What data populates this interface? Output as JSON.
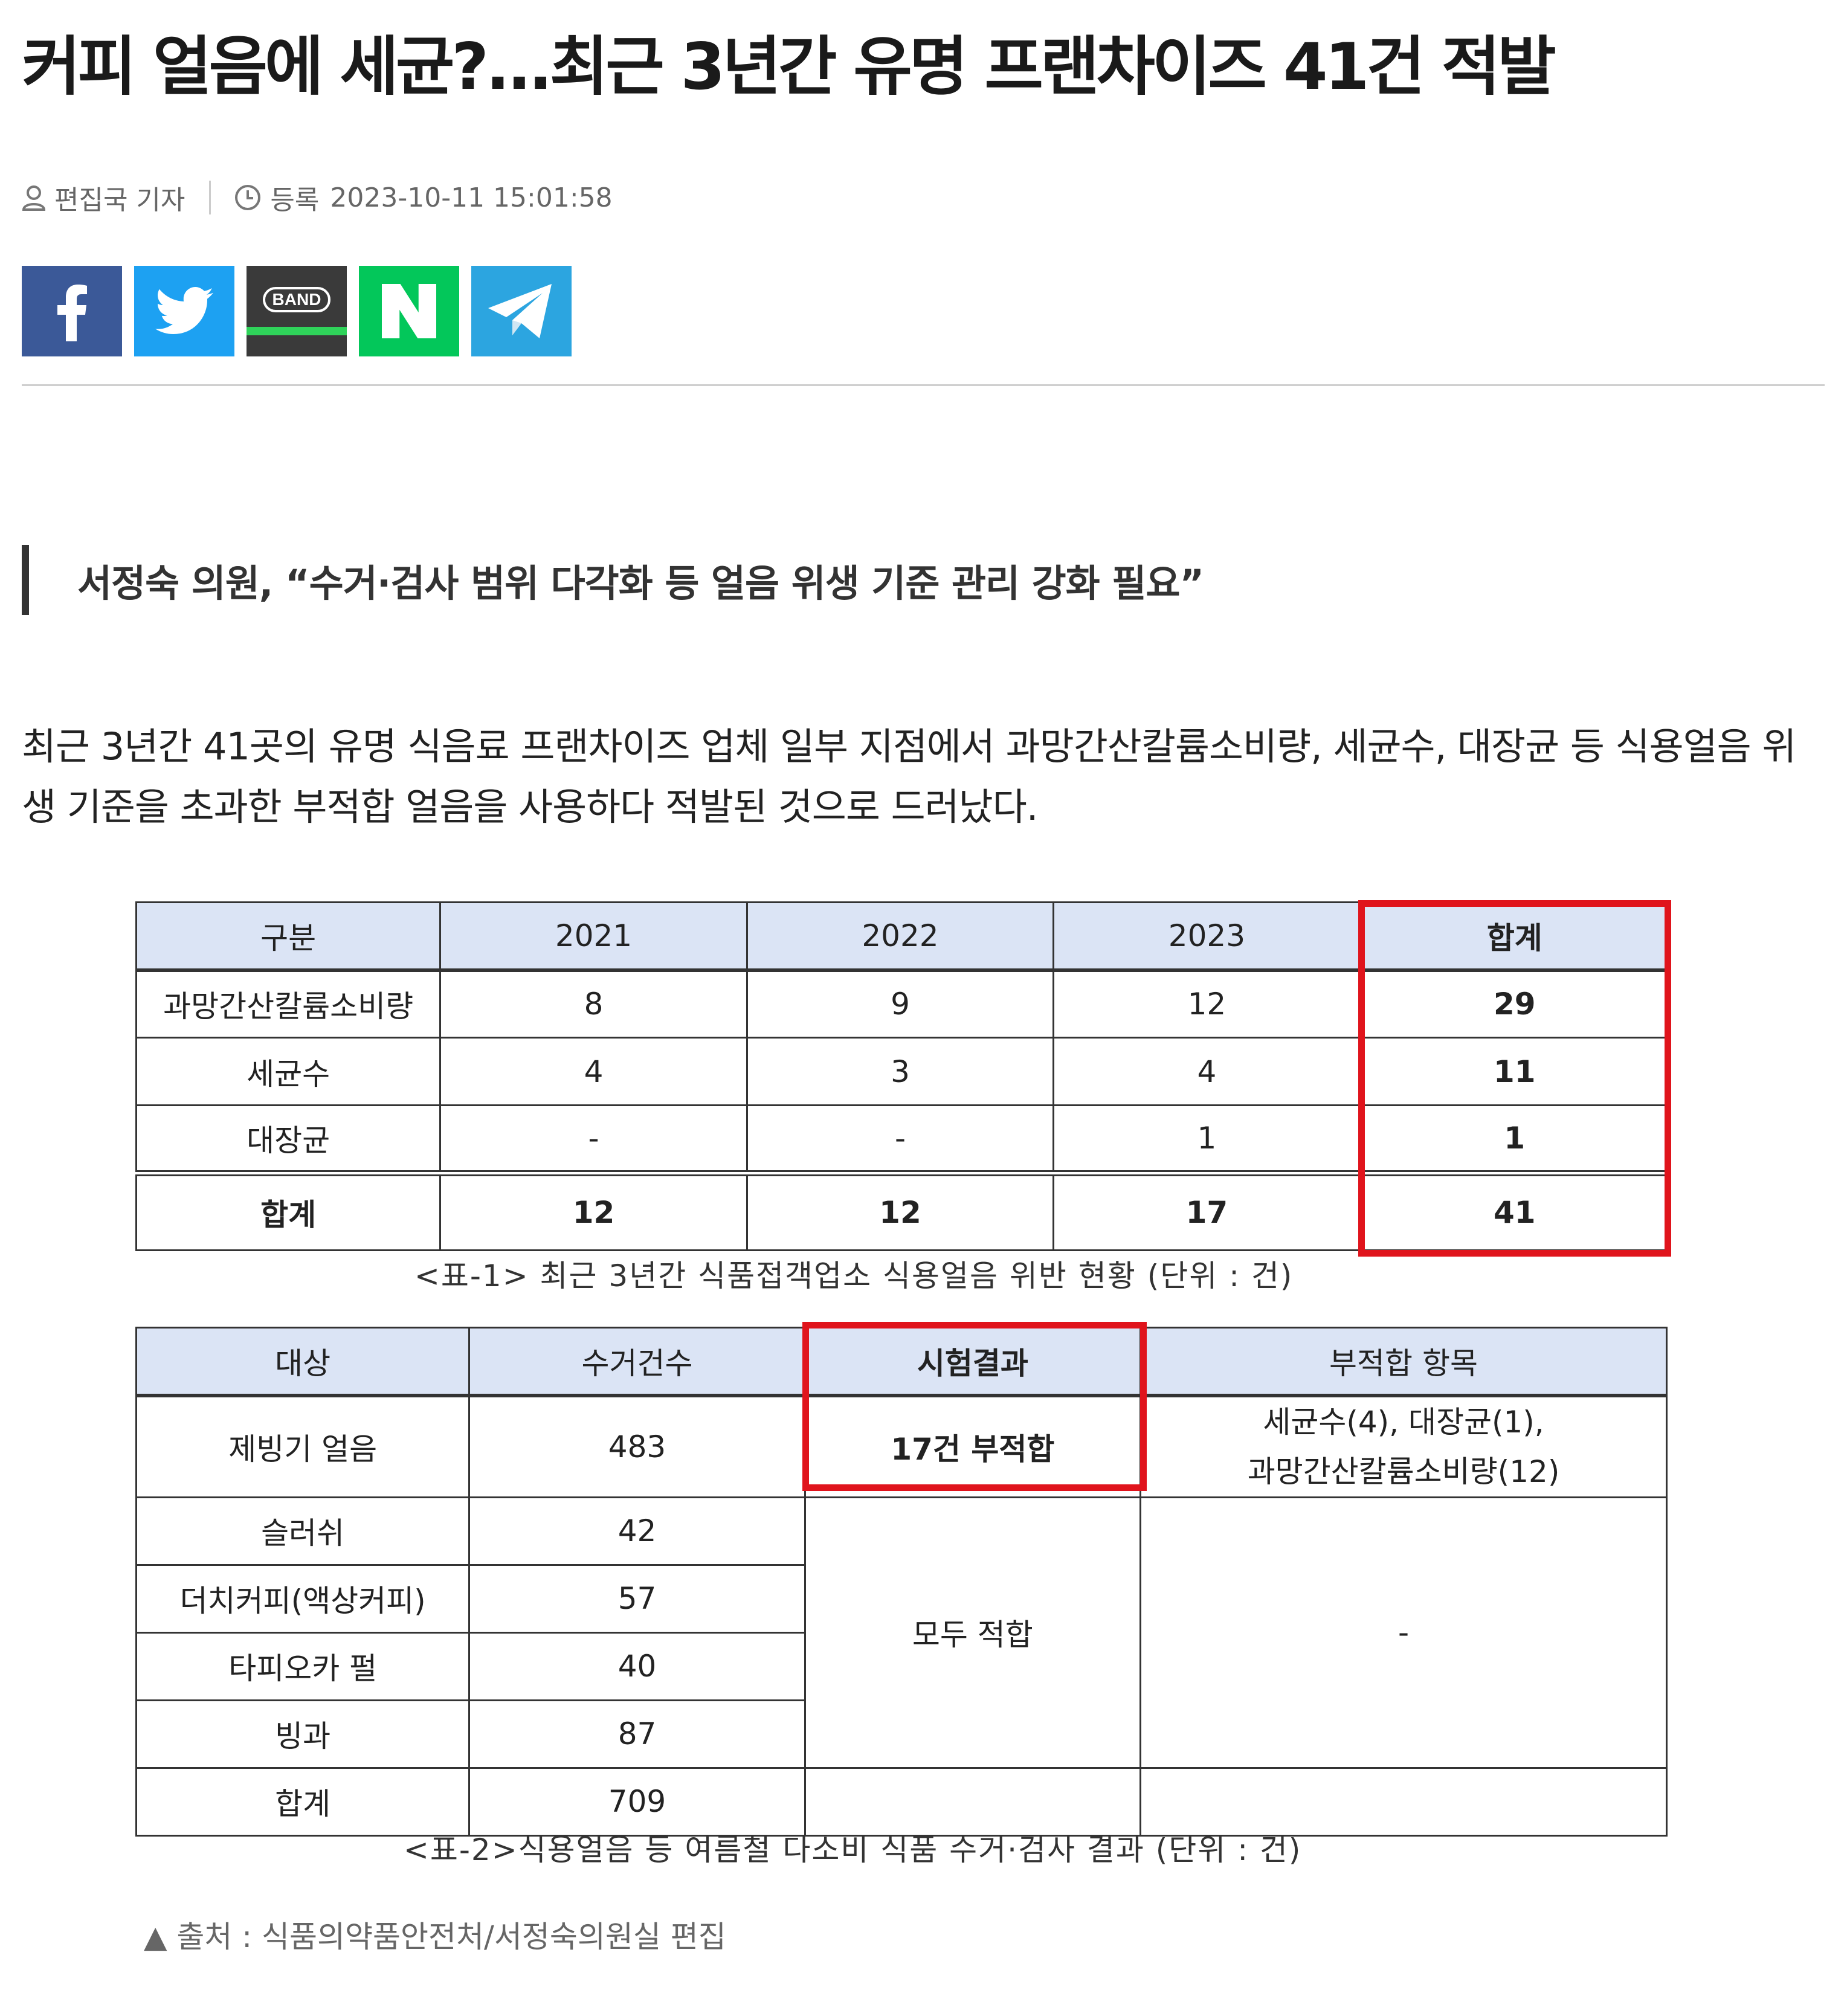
{
  "article": {
    "headline": "커피 얼음에 세균?...최근 3년간 유명 프랜차이즈 41건 적발",
    "author": "편집국 기자",
    "date_label": "등록",
    "date": "2023-10-11 15:01:58",
    "share": {
      "band_label": "BAND"
    },
    "subtitle": "서정숙 의원, “수거·검사 범위 다각화 등 얼음 위생 기준 관리 강화 필요”",
    "body": "최근 3년간 41곳의 유명 식음료 프랜차이즈 업체 일부 지점에서 과망간산칼륨소비량, 세균수, 대장균 등 식용얼음 위생 기준을 초과한 부적합 얼음을 사용하다 적발된 것으로 드러났다."
  },
  "table1": {
    "headers": [
      "구분",
      "2021",
      "2022",
      "2023",
      "합계"
    ],
    "rows": [
      [
        "과망간산칼륨소비량",
        "8",
        "9",
        "12",
        "29"
      ],
      [
        "세균수",
        "4",
        "3",
        "4",
        "11"
      ],
      [
        "대장균",
        "-",
        "-",
        "1",
        "1"
      ]
    ],
    "total": [
      "합계",
      "12",
      "12",
      "17",
      "41"
    ],
    "caption": "<표-1> 최근 3년간 식품접객업소 식용얼음 위반 현황 (단위 : 건)"
  },
  "table2": {
    "headers": [
      "대상",
      "수거건수",
      "시험결과",
      "부적합 항목"
    ],
    "rows": [
      [
        "제빙기 얼음",
        "483"
      ],
      [
        "슬러쉬",
        "42"
      ],
      [
        "더치커피(액상커피)",
        "57"
      ],
      [
        "타피오카 펄",
        "40"
      ],
      [
        "빙과",
        "87"
      ],
      [
        "합계",
        "709"
      ]
    ],
    "result_fail": "17건 부적합",
    "result_pass": "모두 적합",
    "items_line1": "세균수(4), 대장균(1),",
    "items_line2": "과망간산칼륨소비량(12)",
    "items_none": "-",
    "caption": "<표-2>식용얼음 등 여름철 다소비 식품 수거·검사 결과 (단위 : 건)"
  },
  "source": "▲ 출처 : 식품의약품안전처/서정숙의원실 편집"
}
